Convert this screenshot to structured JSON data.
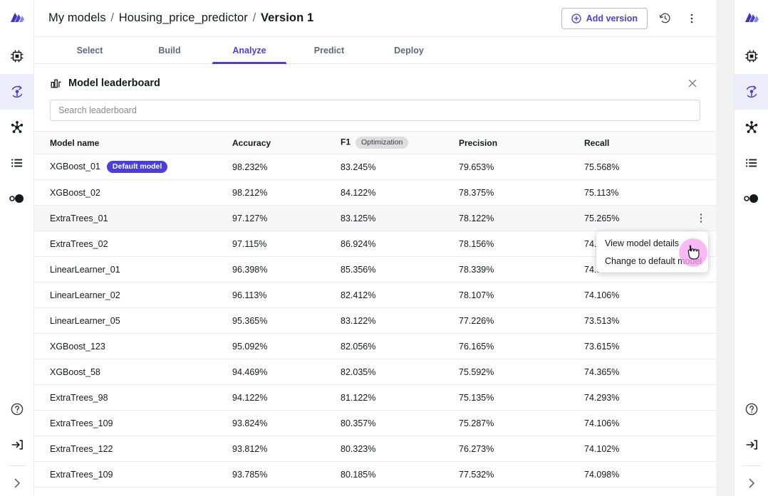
{
  "app": {
    "left_rail": [
      {
        "name": "app-logo-icon",
        "label": "App logo"
      },
      {
        "name": "chip-icon",
        "label": "Models"
      },
      {
        "name": "pipeline-icon",
        "label": "Experiments",
        "active": true
      },
      {
        "name": "network-icon",
        "label": "Network"
      },
      {
        "name": "list-icon",
        "label": "Jobs"
      },
      {
        "name": "toggle-icon",
        "label": "Settings toggle"
      }
    ],
    "left_rail_bottom": [
      {
        "name": "help-icon",
        "label": "Help"
      },
      {
        "name": "signout-icon",
        "label": "Sign out"
      },
      {
        "name": "expand-icon",
        "label": "Expand navigation"
      }
    ],
    "right_rail": [
      {
        "name": "app-logo-icon",
        "label": "App logo"
      },
      {
        "name": "chip-icon",
        "label": "Models"
      },
      {
        "name": "pipeline-icon",
        "label": "Experiments",
        "active": true
      },
      {
        "name": "network-icon",
        "label": "Network"
      },
      {
        "name": "list-icon",
        "label": "Jobs"
      },
      {
        "name": "toggle-icon",
        "label": "Settings toggle"
      }
    ],
    "right_rail_bottom": [
      {
        "name": "help-icon",
        "label": "Help"
      },
      {
        "name": "signout-icon",
        "label": "Sign out"
      },
      {
        "name": "expand-icon",
        "label": "Expand navigation"
      }
    ]
  },
  "breadcrumb": {
    "root": "My models",
    "project": "Housing_price_predictor",
    "current": "Version 1",
    "separator": "/"
  },
  "toolbar": {
    "add_version_label": "Add version",
    "history_icon": "history-icon",
    "more_icon": "more-vertical-icon"
  },
  "tabs": [
    {
      "label": "Select",
      "active": false
    },
    {
      "label": "Build",
      "active": false
    },
    {
      "label": "Analyze",
      "active": true
    },
    {
      "label": "Predict",
      "active": false
    },
    {
      "label": "Deploy",
      "active": false
    }
  ],
  "panel": {
    "title": "Model leaderboard",
    "title_icon": "bar-chart-icon",
    "close_label": "×"
  },
  "search": {
    "value": "",
    "placeholder": "Search leaderboard"
  },
  "table": {
    "columns": [
      {
        "label": "Model name"
      },
      {
        "label": "Accuracy"
      },
      {
        "label": "F1",
        "badge": "Optimization"
      },
      {
        "label": "Precision"
      },
      {
        "label": "Recall"
      }
    ],
    "rows": [
      {
        "model": "XGBoost_01",
        "badge": "Default model",
        "accuracy": "98.232%",
        "f1": "83.245%",
        "precision": "79.653%",
        "recall": "75.568%"
      },
      {
        "model": "XGBoost_02",
        "badge": "",
        "accuracy": "98.212%",
        "f1": "84.122%",
        "precision": "78.375%",
        "recall": "75.113%"
      },
      {
        "model": "ExtraTrees_01",
        "badge": "",
        "accuracy": "97.127%",
        "f1": "83.125%",
        "precision": "78.122%",
        "recall": "75.265%"
      },
      {
        "model": "ExtraTrees_02",
        "badge": "",
        "accuracy": "97.115%",
        "f1": "86.924%",
        "precision": "78.156%",
        "recall": "74.812%"
      },
      {
        "model": "LinearLearner_01",
        "badge": "",
        "accuracy": "96.398%",
        "f1": "85.356%",
        "precision": "78.339%",
        "recall": "74.319%"
      },
      {
        "model": "LinearLearner_02",
        "badge": "",
        "accuracy": "96.113%",
        "f1": "82.412%",
        "precision": "78.107%",
        "recall": "74.106%"
      },
      {
        "model": "LinearLearner_05",
        "badge": "",
        "accuracy": "95.365%",
        "f1": "83.122%",
        "precision": "77.226%",
        "recall": "73.513%"
      },
      {
        "model": "XGBoost_123",
        "badge": "",
        "accuracy": "95.092%",
        "f1": "82.056%",
        "precision": "76.165%",
        "recall": "73.615%"
      },
      {
        "model": "XGBoost_58",
        "badge": "",
        "accuracy": "94.469%",
        "f1": "82.035%",
        "precision": "75.592%",
        "recall": "74.365%"
      },
      {
        "model": "ExtraTrees_98",
        "badge": "",
        "accuracy": "94.122%",
        "f1": "81.122%",
        "precision": "75.135%",
        "recall": "74.293%"
      },
      {
        "model": "ExtraTrees_109",
        "badge": "",
        "accuracy": "93.824%",
        "f1": "80.357%",
        "precision": "75.287%",
        "recall": "74.106%"
      },
      {
        "model": "ExtraTrees_122",
        "badge": "",
        "accuracy": "93.812%",
        "f1": "80.323%",
        "precision": "76.273%",
        "recall": "74.102%"
      },
      {
        "model": "ExtraTrees_109",
        "badge": "",
        "accuracy": "93.785%",
        "f1": "80.185%",
        "precision": "77.532%",
        "recall": "74.098%"
      }
    ]
  },
  "context_menu": {
    "items": [
      {
        "label": "View model details"
      },
      {
        "label": "Change to default model"
      }
    ]
  },
  "colors": {
    "accent": "#4b3ede",
    "accent_light": "#ececfb",
    "badge_default": "#4b3ede",
    "badge_optimization": "#dededf",
    "row_alt": "#f7f7f8",
    "cursor_halo": "#f8a0f0",
    "border": "#e9e9ed"
  }
}
